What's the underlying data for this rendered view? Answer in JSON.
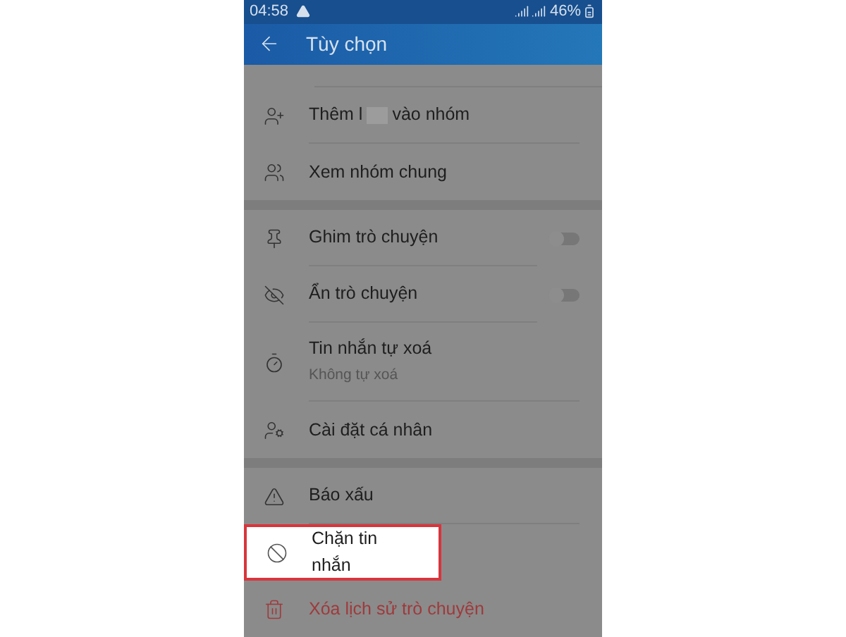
{
  "status_bar": {
    "time": "04:58",
    "battery": "46%"
  },
  "header": {
    "title": "Tùy chọn"
  },
  "sections": [
    {
      "rows": [
        {
          "kind": "add_member",
          "label": "Thêm l",
          "label_after": "vào nhóm",
          "highlighted": false
        },
        {
          "kind": "action",
          "label": "Xem nhóm chung",
          "highlighted": false
        }
      ]
    },
    {
      "rows": [
        {
          "kind": "toggle",
          "label": "Ghim trò chuyện",
          "on": false,
          "highlighted": false
        },
        {
          "kind": "toggle",
          "label": "Ẩn trò chuyện",
          "on": false,
          "highlighted": false
        },
        {
          "kind": "detail",
          "label": "Tin nhắn tự xoá",
          "subtitle": "Không tự xoá",
          "highlighted": false
        },
        {
          "kind": "action",
          "label": "Cài đặt cá nhân",
          "highlighted": false
        }
      ]
    },
    {
      "rows": [
        {
          "kind": "action",
          "label": "Báo xấu",
          "highlighted": false
        },
        {
          "kind": "action",
          "label": "Chặn tin nhắn",
          "highlighted": true
        },
        {
          "kind": "danger",
          "label": "Xóa lịch sử trò chuyện",
          "highlighted": false
        }
      ]
    }
  ]
}
